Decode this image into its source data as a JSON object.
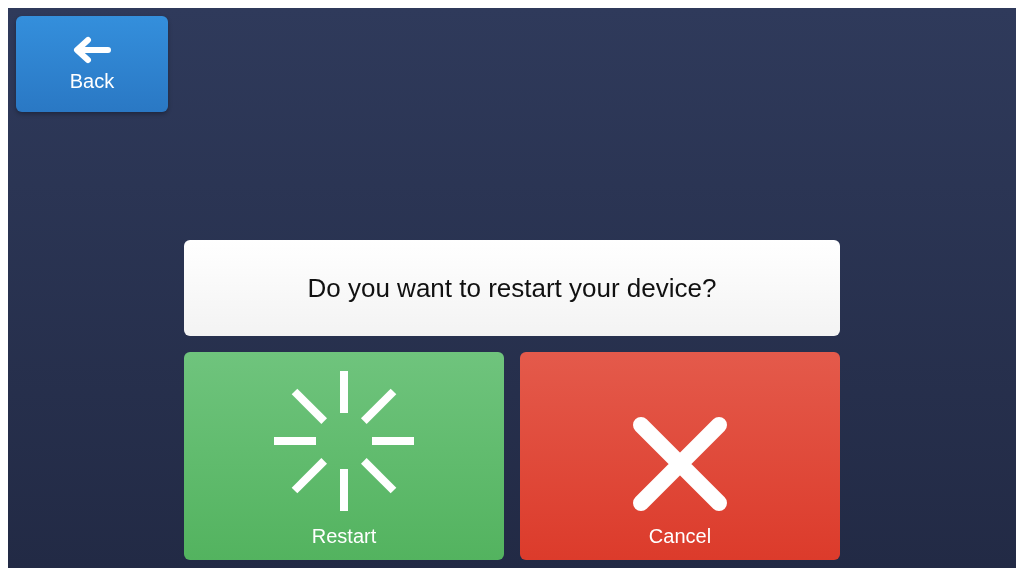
{
  "back_button": {
    "label": "Back"
  },
  "question": "Do you want to restart your device?",
  "actions": [
    {
      "kind": "restart",
      "label": "Restart"
    },
    {
      "kind": "cancel",
      "label": "Cancel"
    }
  ]
}
